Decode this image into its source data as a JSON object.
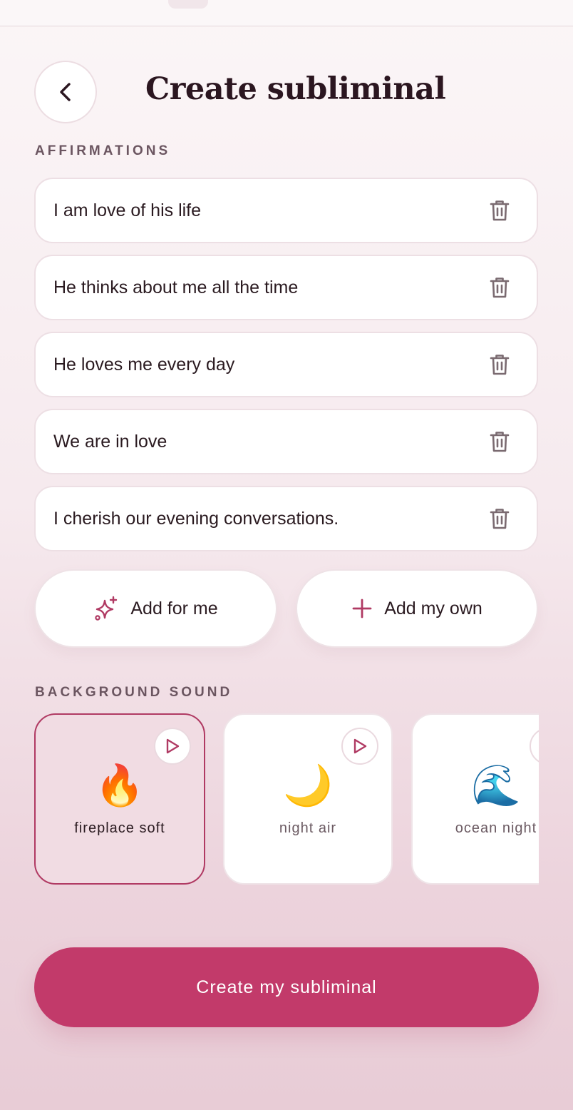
{
  "header": {
    "title": "Create subliminal",
    "back_icon": "chevron-left-icon"
  },
  "affirmations": {
    "label": "AFFIRMATIONS",
    "items": [
      {
        "text": "I am love of his life"
      },
      {
        "text": "He thinks about me all the time"
      },
      {
        "text": "He loves me every day"
      },
      {
        "text": "We are in love"
      },
      {
        "text": "I cherish our evening conversations."
      }
    ],
    "delete_icon": "trash-icon"
  },
  "actions": {
    "add_for_me": "Add for me",
    "add_for_me_icon": "sparkles-icon",
    "add_my_own": "Add my own",
    "add_my_own_icon": "plus-icon"
  },
  "background_sound": {
    "label": "BACKGROUND SOUND",
    "selected": "fireplace soft",
    "items": [
      {
        "name": "fireplace soft",
        "emoji": "🔥"
      },
      {
        "name": "night air",
        "emoji": "🌙"
      },
      {
        "name": "ocean night",
        "emoji": "🌊"
      }
    ],
    "play_icon": "play-icon"
  },
  "cta": {
    "label": "Create my subliminal"
  },
  "colors": {
    "accent": "#c23a6a",
    "selected_border": "#b03a63",
    "selected_bg": "#f1dce3",
    "icon_muted": "#7a6a70"
  }
}
